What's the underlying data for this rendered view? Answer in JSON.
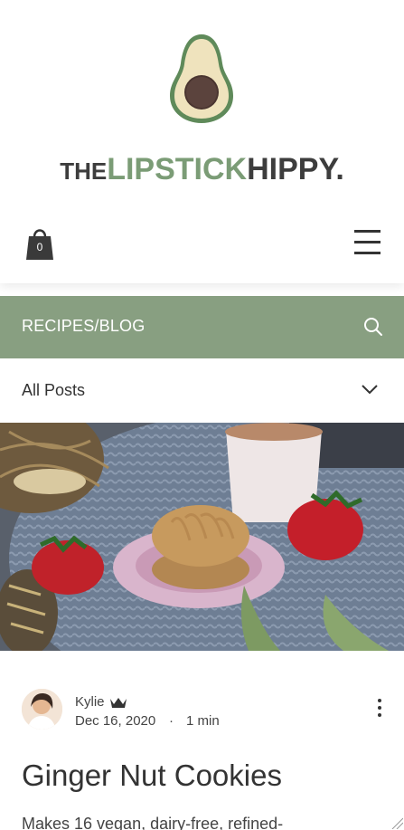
{
  "header": {
    "logo_the": "THE",
    "logo_lipstick": "LIPSTICK",
    "logo_hippy": "HIPPY.",
    "cart_count": "0",
    "cart_icon": "shopping-bag-icon",
    "menu_icon": "hamburger-menu-icon"
  },
  "section_bar": {
    "title": "RECIPES/BLOG",
    "search_icon": "search-icon",
    "color": "#889f81"
  },
  "filter": {
    "selected": "All Posts",
    "icon": "chevron-down-icon"
  },
  "post": {
    "author": "Kylie",
    "author_badge_icon": "crown-icon",
    "date": "Dec 16, 2020",
    "separator": "·",
    "read_time": "1 min",
    "title": "Ginger Nut Cookies",
    "excerpt": "Makes 16 vegan, dairy-free, refined-",
    "more_icon": "more-options-icon"
  },
  "colors": {
    "accent_green": "#7b9c76",
    "text_dark": "#333333"
  }
}
